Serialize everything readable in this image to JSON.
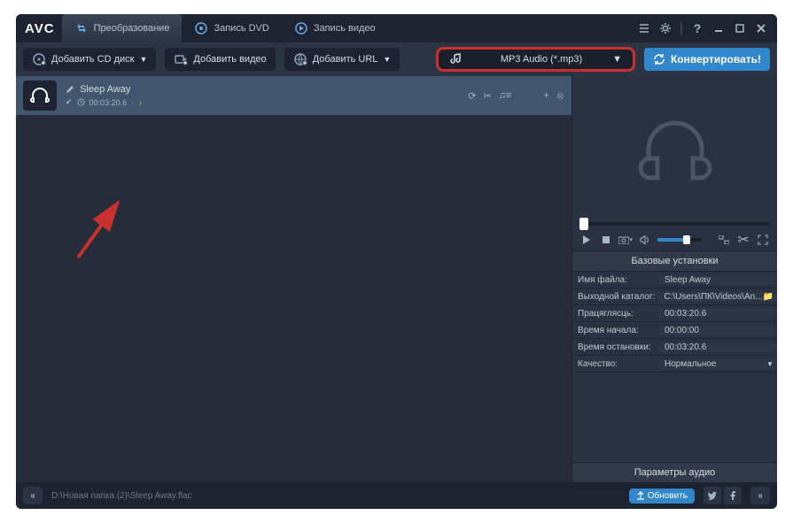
{
  "logo": "AVC",
  "tabs": [
    {
      "label": "Преобразование",
      "icon": "convert"
    },
    {
      "label": "Запись DVD",
      "icon": "dvd"
    },
    {
      "label": "Запись видео",
      "icon": "record"
    }
  ],
  "toolbar": {
    "add_cd": "Добавить CD диск",
    "add_video": "Добавить видео",
    "add_url": "Добавить URL",
    "format": "MP3 Audio (*.mp3)",
    "convert": "Конвертировать!"
  },
  "file": {
    "title": "Sleep Away",
    "duration": "00:03:20.6"
  },
  "settings": {
    "header": "Базовые установки",
    "rows": [
      {
        "k": "Имя файла:",
        "v": "Sleep Away"
      },
      {
        "k": "Выходной каталог:",
        "v": "C:\\Users\\ПК\\Videos\\An..."
      },
      {
        "k": "Працяглясць:",
        "v": "00:03:20.6"
      },
      {
        "k": "Время начала:",
        "v": "00:00:00"
      },
      {
        "k": "Время остановки:",
        "v": "00:03:20.6"
      },
      {
        "k": "Качество:",
        "v": "Нормальное"
      }
    ],
    "audio_params": "Параметры аудио"
  },
  "status": {
    "path": "D:\\Новая папка (2)\\Sleep Away.flac",
    "update": "Обновить"
  }
}
